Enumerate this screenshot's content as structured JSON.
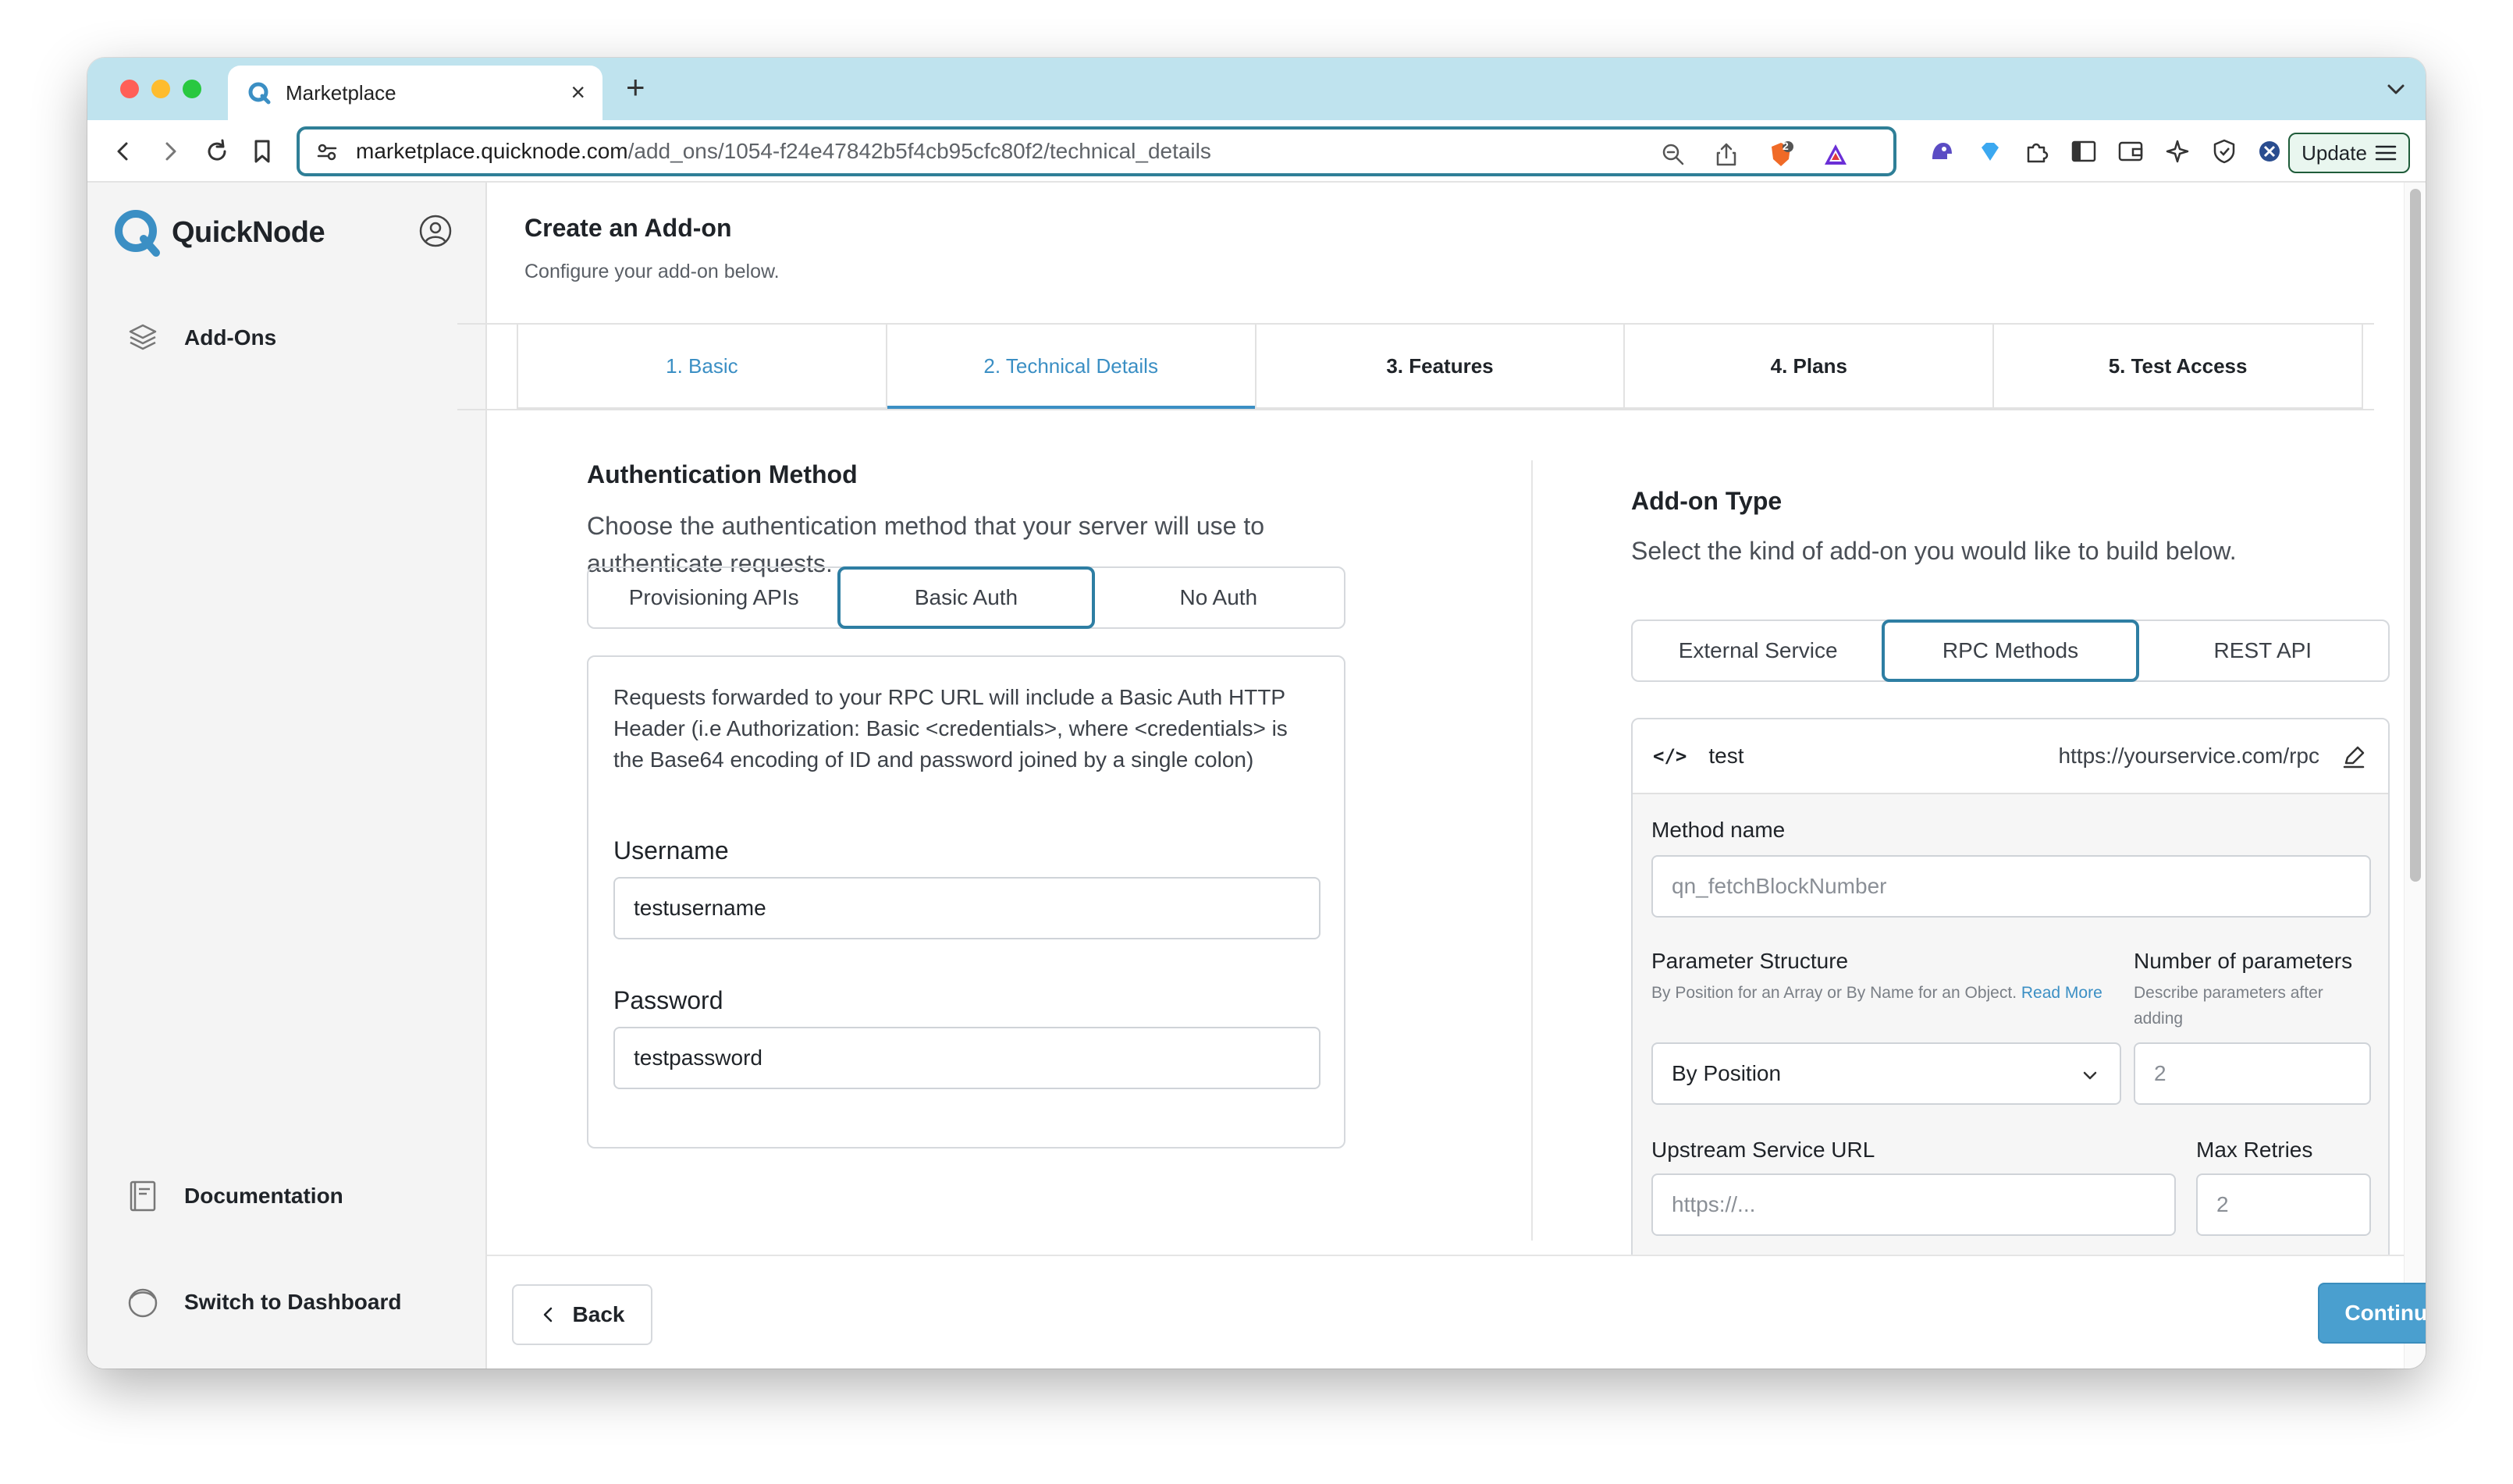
{
  "browser": {
    "tab_title": "Marketplace",
    "tab_close": "×",
    "new_tab": "+",
    "url_host": "marketplace.quicknode.com",
    "url_path": "/add_ons/1054-f24e47842b5f4cb95cfc80f2/technical_details",
    "shield_badge": "2",
    "update_label": "Update"
  },
  "sidebar": {
    "brand": "QuickNode",
    "items": [
      {
        "label": "Add-Ons",
        "icon": "layers-icon"
      },
      {
        "label": "Documentation",
        "icon": "book-icon"
      },
      {
        "label": "Switch to Dashboard",
        "icon": "switch-icon"
      }
    ]
  },
  "header": {
    "title": "Create an Add-on",
    "subtitle": "Configure your add-on below."
  },
  "steps": [
    {
      "label": "1. Basic",
      "state": "done"
    },
    {
      "label": "2. Technical Details",
      "state": "active"
    },
    {
      "label": "3. Features",
      "state": "todo"
    },
    {
      "label": "4. Plans",
      "state": "todo"
    },
    {
      "label": "5. Test Access",
      "state": "todo"
    }
  ],
  "auth": {
    "title": "Authentication Method",
    "description": "Choose the authentication method that your server will use to authenticate requests.",
    "options": [
      "Provisioning APIs",
      "Basic Auth",
      "No Auth"
    ],
    "selected": "Basic Auth",
    "note": "Requests forwarded to your RPC URL will include a Basic Auth HTTP Header (i.e Authorization: Basic <credentials>, where <credentials> is the Base64 encoding of ID and password joined by a single colon)",
    "username_label": "Username",
    "username_value": "testusername",
    "password_label": "Password",
    "password_value": "testpassword"
  },
  "addon_type": {
    "title": "Add-on Type",
    "description": "Select the kind of add-on you would like to build below.",
    "options": [
      "External Service",
      "RPC Methods",
      "REST API"
    ],
    "selected": "RPC Methods"
  },
  "rpc_method": {
    "code_icon": "</>",
    "name": "test",
    "url": "https://yourservice.com/rpc",
    "method_name_label": "Method name",
    "method_name_placeholder": "qn_fetchBlockNumber",
    "param_structure_label": "Parameter Structure",
    "param_structure_help": "By Position for an Array or By Name for an Object.",
    "param_structure_help_link": "Read More",
    "param_structure_value": "By Position",
    "num_params_label": "Number of parameters",
    "num_params_help": "Describe parameters after adding",
    "num_params_placeholder": "2",
    "upstream_label": "Upstream Service URL",
    "upstream_placeholder": "https://...",
    "max_retries_label": "Max Retries",
    "max_retries_placeholder": "2"
  },
  "footer": {
    "back_label": "Back",
    "continue_label": "Continue"
  },
  "colors": {
    "accent": "#3b8fc4",
    "selected_border": "#2e7ea3",
    "continue_bg": "#4a9fcf",
    "chrome_tabbar": "#bfe3ee"
  }
}
